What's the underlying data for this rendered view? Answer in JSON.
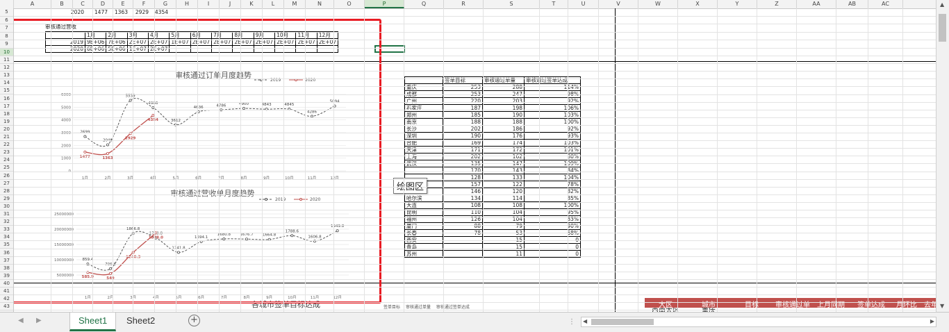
{
  "columns": [
    "A",
    "B",
    "C",
    "D",
    "E",
    "F",
    "G",
    "H",
    "I",
    "J",
    "K",
    "L",
    "M",
    "N",
    "O",
    "P",
    "Q",
    "R",
    "S",
    "T",
    "U",
    "V",
    "W",
    "X",
    "Y",
    "Z",
    "AA",
    "AB",
    "AC"
  ],
  "rows": [
    "5",
    "6",
    "7",
    "8",
    "9",
    "10",
    "11",
    "12",
    "13",
    "14",
    "15",
    "16",
    "17",
    "18",
    "19",
    "20",
    "21",
    "22",
    "23",
    "24",
    "25",
    "26",
    "27",
    "28",
    "29",
    "30",
    "31",
    "32",
    "33",
    "34",
    "35",
    "36",
    "37",
    "38",
    "39",
    "40",
    "41",
    "42",
    "43"
  ],
  "row5": {
    "c1": "2020",
    "c2": "1477",
    "c3": "1363",
    "c4": "2929",
    "c5": "4354"
  },
  "revenue_table": {
    "title": "审核通过营收",
    "months": [
      "1月",
      "2月",
      "3月",
      "4月",
      "5月",
      "6月",
      "7月",
      "8月",
      "9月",
      "10月",
      "11月",
      "12月"
    ],
    "rows": [
      {
        "year": "2019",
        "values": [
          "9E+06",
          "7E+06",
          "2E+07",
          "2E+07",
          "1E+07",
          "2E+07",
          "2E+07",
          "2E+07",
          "2E+07",
          "2E+07",
          "2E+07",
          "2E+07"
        ]
      },
      {
        "year": "2020",
        "values": [
          "6E+06",
          "5E+06",
          "1E+07",
          "2E+07",
          "",
          "",
          "",
          "",
          "",
          "",
          "",
          ""
        ]
      }
    ]
  },
  "city_table": {
    "headers": [
      "",
      "签单目标",
      "审核通过单量",
      "审核通过签单达成"
    ],
    "rows": [
      [
        "重庆",
        "253",
        "288",
        "114%"
      ],
      [
        "成都",
        "253",
        "247",
        "98%"
      ],
      [
        "广州",
        "220",
        "203",
        "92%"
      ],
      [
        "石家庄",
        "187",
        "198",
        "106%"
      ],
      [
        "郑州",
        "185",
        "190",
        "103%"
      ],
      [
        "南京",
        "188",
        "188",
        "100%"
      ],
      [
        "长沙",
        "202",
        "186",
        "92%"
      ],
      [
        "深圳",
        "190",
        "176",
        "93%"
      ],
      [
        "合肥",
        "169",
        "174",
        "103%"
      ],
      [
        "天津",
        "171",
        "172",
        "101%"
      ],
      [
        "上海",
        "202",
        "162",
        "80%"
      ],
      [
        "武汉",
        "135",
        "147",
        "109%"
      ],
      [
        "",
        "170",
        "143",
        "84%"
      ],
      [
        "",
        "128",
        "133",
        "104%"
      ],
      [
        "济南",
        "157",
        "122",
        "78%"
      ],
      [
        "杭州",
        "146",
        "120",
        "82%"
      ],
      [
        "哈尔滨",
        "134",
        "114",
        "85%"
      ],
      [
        "大连",
        "108",
        "108",
        "100%"
      ],
      [
        "昆明",
        "110",
        "104",
        "95%"
      ],
      [
        "福州",
        "126",
        "104",
        "83%"
      ],
      [
        "厦门",
        "88",
        "79",
        "90%"
      ],
      [
        "长春",
        "78",
        "53",
        "68%"
      ],
      [
        "西安",
        "",
        "15",
        "0"
      ],
      [
        "青岛",
        "",
        "15",
        "0"
      ],
      [
        "苏州",
        "",
        "11",
        "0"
      ]
    ]
  },
  "tooltip": "绘图区",
  "bottom_chart_title": "各城市签单目标达成",
  "bottom_legend": [
    "签单目标",
    "审核通过单量",
    "审核通过签单达成"
  ],
  "region_header": [
    "大区",
    "城市",
    "目标",
    "审核通过单",
    "上月同期",
    "签单达成",
    "月环比",
    "去年"
  ],
  "region_row": [
    "西南大区",
    "重庆"
  ],
  "tabs": [
    "Sheet1",
    "Sheet2"
  ],
  "add_sheet": "+",
  "colors": {
    "s2019": "#555555",
    "s2020": "#c0504d",
    "selection": "#e81c24",
    "header_band": "#c0504d"
  },
  "chart_data": [
    {
      "type": "line",
      "title": "审核通过订单月度趋势",
      "categories": [
        "1月",
        "2月",
        "3月",
        "4月",
        "5月",
        "6月",
        "7月",
        "8月",
        "9月",
        "10月",
        "11月",
        "12月"
      ],
      "ylim": [
        0,
        6000
      ],
      "yticks": [
        "0",
        "1000",
        "2000",
        "3000",
        "4000",
        "5000",
        "6000"
      ],
      "series": [
        {
          "name": "2019",
          "values": [
            2699,
            2048,
            5539,
            4966,
            3612,
            4636,
            4786,
            4900,
            4843,
            4845,
            4286,
            5094
          ],
          "labels": [
            "2699",
            "2048",
            "5539",
            "4966",
            "3612",
            "4636",
            "4786",
            "4900",
            "4843",
            "4845",
            "4286",
            "5094"
          ]
        },
        {
          "name": "2020",
          "values": [
            1477,
            1363,
            2929,
            4354
          ],
          "labels": [
            "1477",
            "1363",
            "2929",
            "4354"
          ]
        }
      ]
    },
    {
      "type": "line",
      "title": "审核通过营收单月度趋势",
      "categories": [
        "1月",
        "2月",
        "3月",
        "4月",
        "5月",
        "6月",
        "7月",
        "8月",
        "9月",
        "10月",
        "11月",
        "12月"
      ],
      "ylim": [
        0,
        25000000
      ],
      "yticks": [
        "5000000",
        "10000000",
        "15000000",
        "20000000",
        "25000000"
      ],
      "series": [
        {
          "name": "2019",
          "values": [
            8594000,
            7068000,
            18668000,
            17108000,
            12418000,
            15941000,
            16808000,
            16767000,
            16648000,
            17886000,
            16068000,
            19498000
          ],
          "labels": [
            "859.4",
            "706.8",
            "1866.8",
            "1710.8",
            "1241.8",
            "1594.1",
            "1680.8",
            "1676.7",
            "1664.8",
            "1788.6",
            "1606.8",
            "1949.8"
          ]
        },
        {
          "name": "2020",
          "values": [
            5859000,
            5490000,
            12403000,
            18780000
          ],
          "labels": [
            "585.9",
            "549",
            "1240.3",
            "1878.0"
          ]
        }
      ]
    }
  ]
}
